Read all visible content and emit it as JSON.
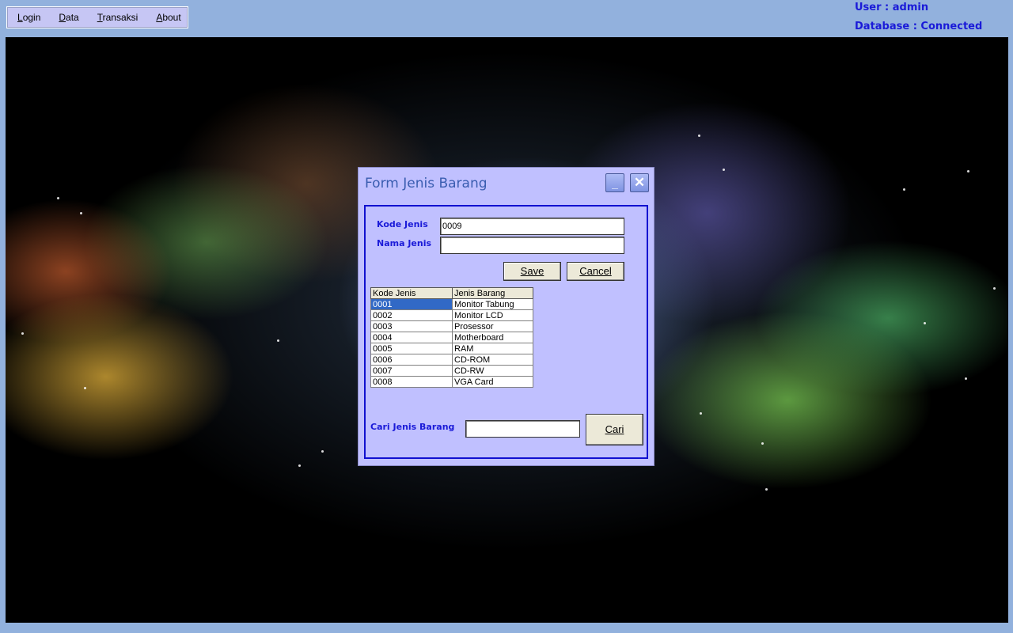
{
  "menubar": {
    "items": [
      {
        "pre": "",
        "ul": "L",
        "rest": "ogin"
      },
      {
        "pre": "",
        "ul": "D",
        "rest": "ata"
      },
      {
        "pre": "",
        "ul": "T",
        "rest": "ransaksi"
      },
      {
        "pre": "",
        "ul": "A",
        "rest": "bout"
      }
    ]
  },
  "status": {
    "user": "User : admin",
    "database": "Database : Connected"
  },
  "dialog": {
    "title": "Form Jenis Barang",
    "minimize_glyph": "_",
    "close_glyph": "✕",
    "kode_label": "Kode Jenis",
    "kode_value": "0009",
    "nama_label": "Nama Jenis",
    "nama_value": "",
    "save_label": "Save",
    "cancel_label": "Cancel",
    "search_label": "Cari Jenis Barang",
    "search_value": "",
    "search_button": "Cari"
  },
  "grid": {
    "headers": [
      "Kode Jenis",
      "Jenis Barang"
    ],
    "rows": [
      [
        "0001",
        "Monitor Tabung"
      ],
      [
        "0002",
        "Monitor LCD"
      ],
      [
        "0003",
        "Prosessor"
      ],
      [
        "0004",
        "Motherboard"
      ],
      [
        "0005",
        "RAM"
      ],
      [
        "0006",
        "CD-ROM"
      ],
      [
        "0007",
        "CD-RW"
      ],
      [
        "0008",
        "VGA Card"
      ]
    ],
    "selected_row": 0
  },
  "colors": {
    "accent_text": "#1a1ad8",
    "dialog_bg": "#c0c0ff",
    "selection": "#3169c6"
  }
}
